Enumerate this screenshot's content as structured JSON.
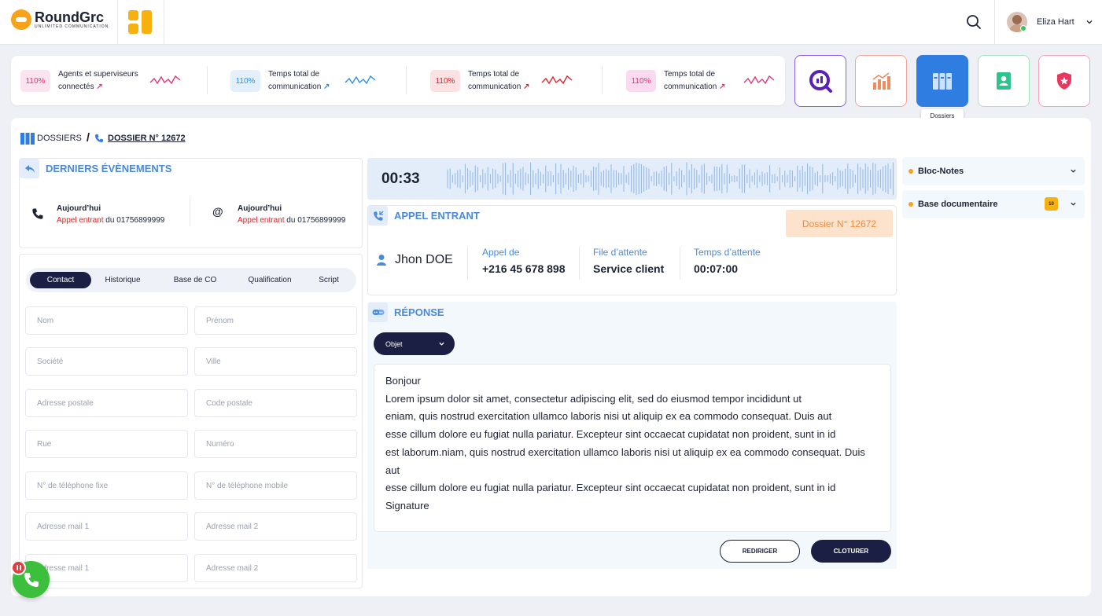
{
  "app": {
    "logo_name": "RoundGrc",
    "logo_tagline": "UNLIMITED COMMUNICATION"
  },
  "user": {
    "name": "Eliza Hart"
  },
  "kpis": [
    {
      "value": "110%",
      "label_line1": "Agents et superviseurs",
      "label_line2": "connectés",
      "color": "#e0367a",
      "bg": "#fce4ee"
    },
    {
      "value": "110%",
      "label_line1": "Temps total de",
      "label_line2": "communication",
      "color": "#2f8fe0",
      "bg": "#e3f0fb"
    },
    {
      "value": "110%",
      "label_line1": "Temps total de",
      "label_line2": "communication",
      "color": "#d9262c",
      "bg": "#fbe1e1"
    },
    {
      "value": "110%",
      "label_line1": "Temps total de",
      "label_line2": "communication",
      "color": "#e0367a",
      "bg": "#fbd9ee"
    }
  ],
  "quick_buttons": [
    {
      "name": "reports",
      "border": "#8b5cf6"
    },
    {
      "name": "statistics",
      "border": "#f4a59a"
    },
    {
      "name": "dossiers",
      "border": "#2f7de0",
      "active": true
    },
    {
      "name": "contacts",
      "border": "#a7e4c4"
    },
    {
      "name": "security",
      "border": "#f7a3b5"
    }
  ],
  "tooltip": "Dossiers",
  "breadcrumb": {
    "root": "DOSSIERS",
    "sep": "/",
    "current": "DOSSIER N° 12672"
  },
  "events": {
    "title": "DERNIERS ÉVÈNEMENTS",
    "items": [
      {
        "day": "Aujourd’hui",
        "type": "Appel entrant",
        "du": "du",
        "number": "01756899999"
      },
      {
        "day": "Aujourd’hui",
        "type": "Appel entrant",
        "du": "du",
        "number": "01756899999"
      }
    ]
  },
  "tabs": [
    "Contact",
    "Historique",
    "Base de CO",
    "Qualification",
    "Script"
  ],
  "form_fields": [
    "Nom",
    "Prénom",
    "Société",
    "Ville",
    "Adresse postale",
    "Code postale",
    "Rue",
    "Numéro",
    "N° de téléphone fixe",
    "N° de téléphone mobile",
    "Adresse mail 1",
    "Adresse mail 2",
    "Adresse mail 1",
    "Adresse mail 2"
  ],
  "audio": {
    "timer": "00:33"
  },
  "call": {
    "title": "APPEL ENTRANT",
    "dossier": "Dossier N° 12672",
    "caller": "Jhon DOE",
    "from_label": "Appel de",
    "from_value": "+216 45 678 898",
    "queue_label": "File d’attente",
    "queue_value": "Service client",
    "wait_label": "Temps d’attente",
    "wait_value": "00:07:00"
  },
  "reponse": {
    "title": "RÉPONSE",
    "objet": "Objet",
    "body": [
      "Bonjour",
      "Lorem ipsum dolor sit amet, consectetur adipiscing elit, sed do eiusmod tempor incididunt ut",
      "eniam, quis nostrud exercitation ullamco laboris nisi ut aliquip ex ea commodo consequat. Duis aut",
      "esse cillum dolore eu fugiat nulla pariatur. Excepteur sint occaecat cupidatat non proident, sunt in  id",
      "est laborum.niam, quis nostrud exercitation ullamco laboris nisi ut aliquip ex ea commodo consequat. Duis aut",
      "esse cillum dolore eu fugiat nulla pariatur. Excepteur sint occaecat cupidatat non proident, sunt in  id",
      "Signature"
    ],
    "redirect_label": "REDIRIGER",
    "close_label": "CLOTURER"
  },
  "sidebar": {
    "items": [
      {
        "label": "Bloc-Notes"
      },
      {
        "label": "Base documentaire",
        "count": "10"
      }
    ]
  }
}
